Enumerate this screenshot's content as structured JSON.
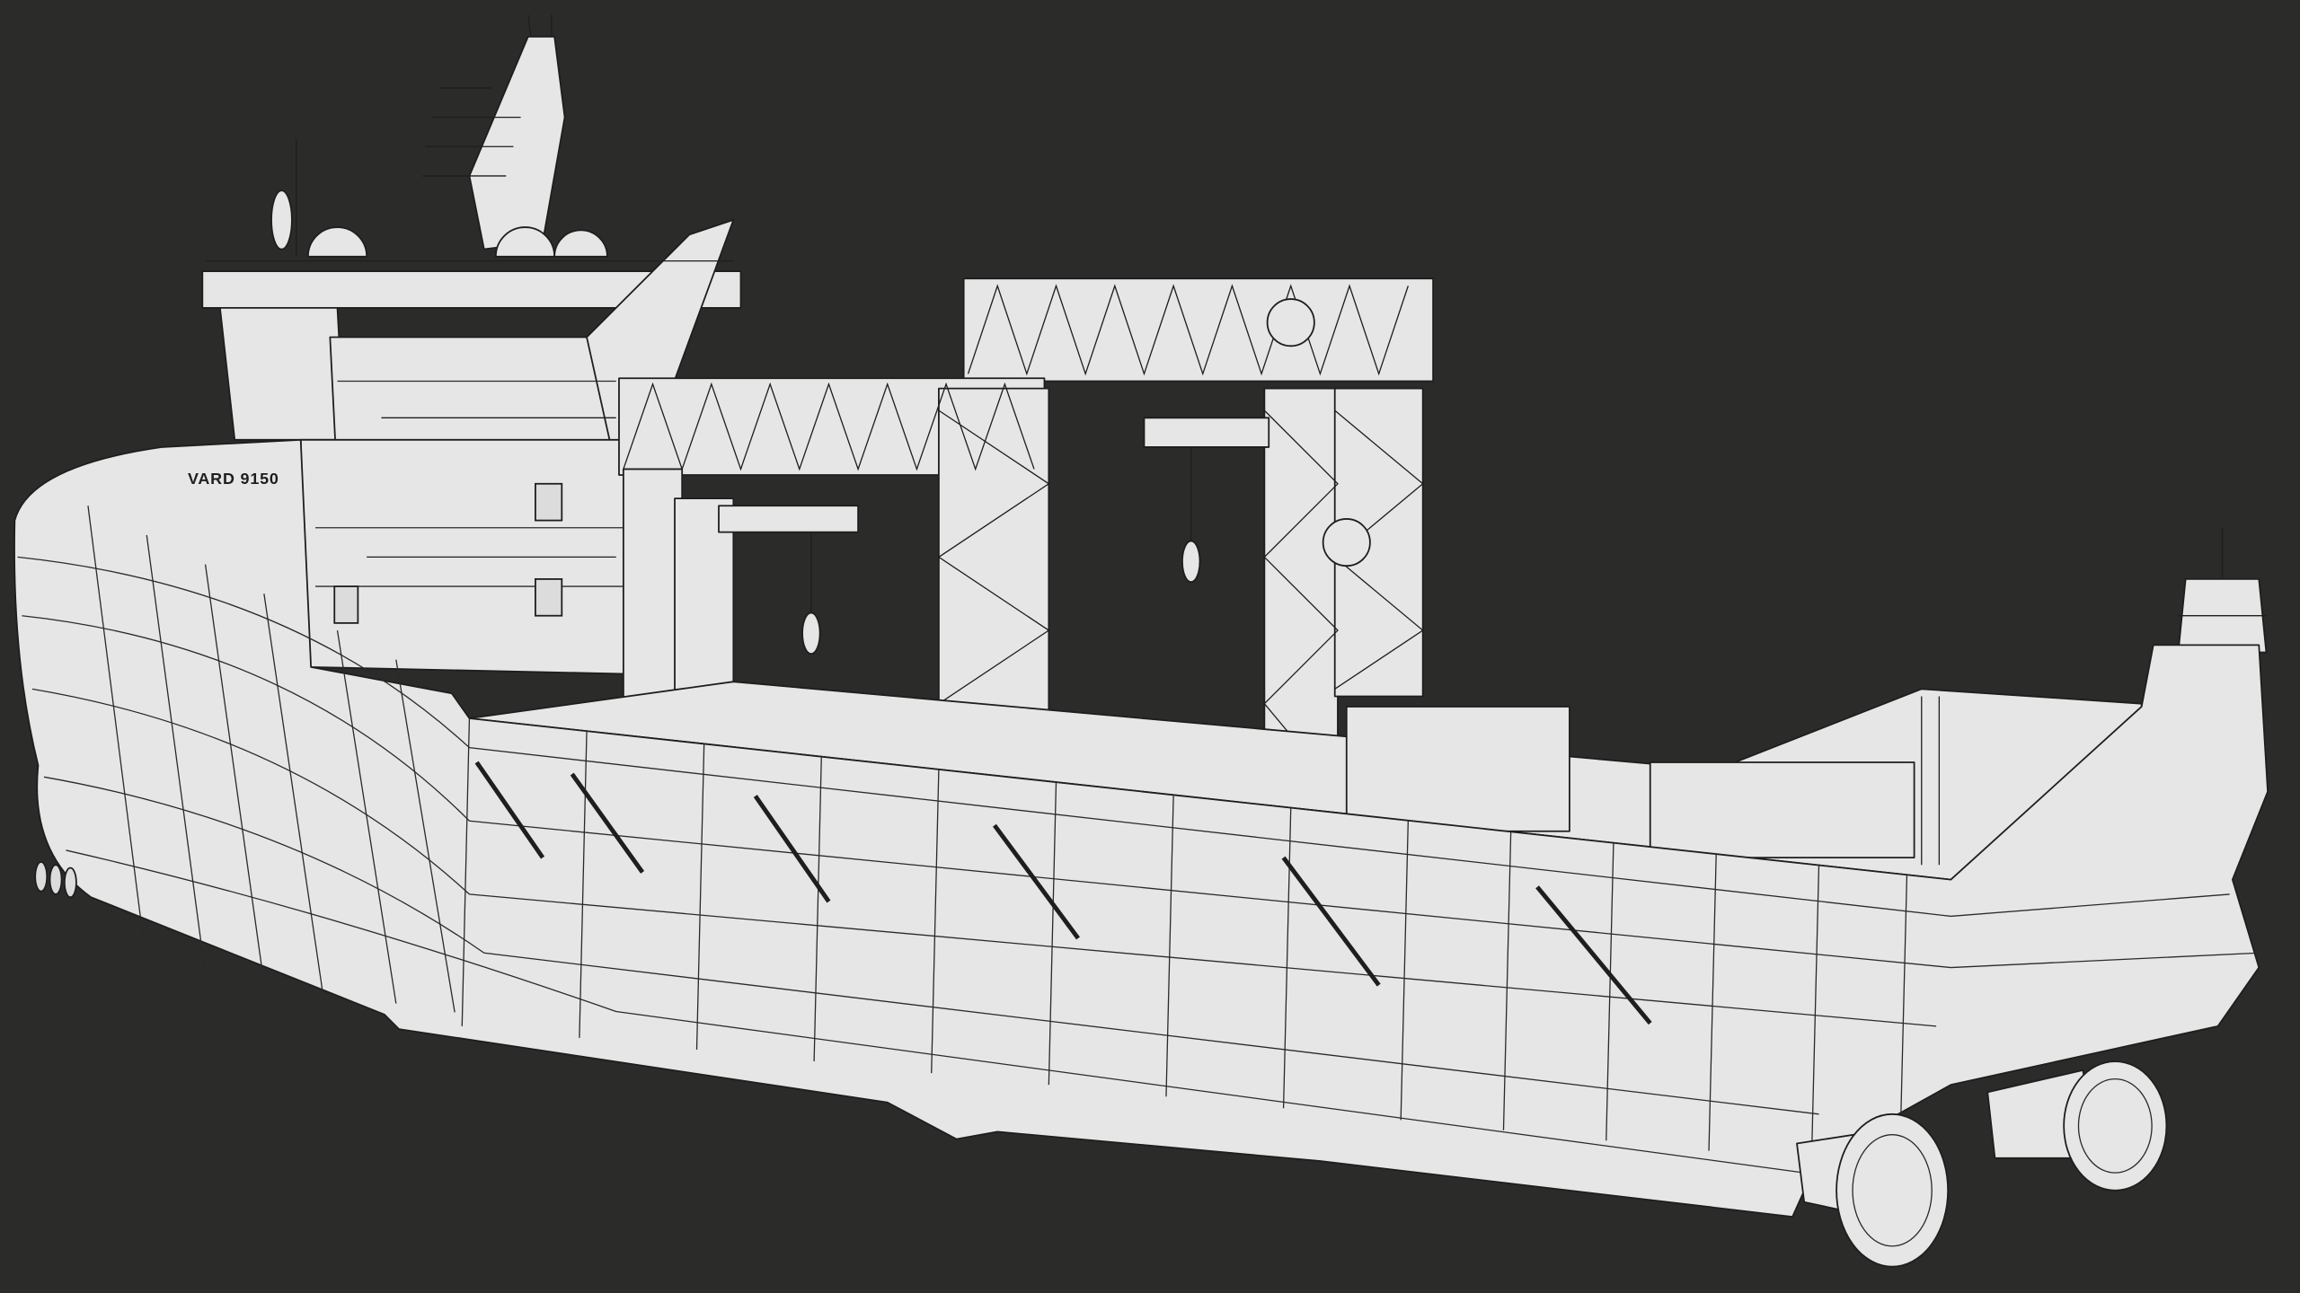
{
  "scene": {
    "subject": "ship-wireframe-render",
    "hull_name": "VARD 9150",
    "background_color": "#2b2b2a",
    "model_color": "#e6e6e6",
    "wire_color": "#1e1e1e"
  }
}
